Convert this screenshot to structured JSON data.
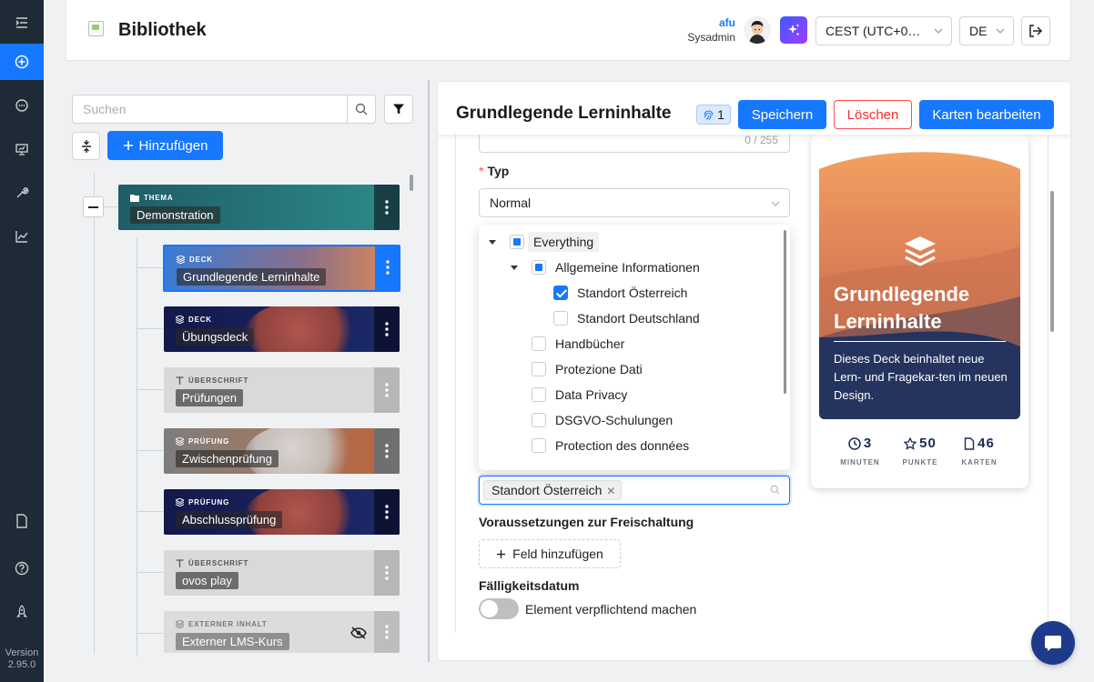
{
  "sidebar": {
    "icons": [
      "menu-icon",
      "add-circle-icon",
      "chat-icon",
      "presentation-icon",
      "tools-icon",
      "chart-icon",
      "document-icon",
      "help-icon",
      "rocket-icon"
    ],
    "version_label": "Version",
    "version_number": "2.95.0"
  },
  "header": {
    "title": "Bibliothek",
    "user_name": "afu",
    "user_role": "Sysadmin",
    "timezone": "CEST (UTC+0…",
    "language": "DE"
  },
  "tree": {
    "search_placeholder": "Suchen",
    "add_label": "Hinzufügen",
    "nodes": [
      {
        "type": "THEMA",
        "label": "Demonstration"
      },
      {
        "type": "DECK",
        "label": "Grundlegende Lerninhalte"
      },
      {
        "type": "DECK",
        "label": "Übungsdeck"
      },
      {
        "type": "ÜBERSCHRIFT",
        "label": "Prüfungen"
      },
      {
        "type": "PRÜFUNG",
        "label": "Zwischenprüfung"
      },
      {
        "type": "PRÜFUNG",
        "label": "Abschlussprüfung"
      },
      {
        "type": "ÜBERSCHRIFT",
        "label": "ovos play"
      },
      {
        "type": "EXTERNER INHALT",
        "label": "Externer LMS-Kurs"
      }
    ]
  },
  "editor": {
    "title": "Grundlegende Lerninhalte",
    "badge_count": "1",
    "save_label": "Speichern",
    "delete_label": "Löschen",
    "edit_cards_label": "Karten bearbeiten",
    "prev_counter": "0 / 255",
    "type_label": "Typ",
    "type_value": "Normal",
    "tree_options": [
      {
        "label": "Everything",
        "state": "partial"
      },
      {
        "label": "Allgemeine Informationen",
        "state": "partial"
      },
      {
        "label": "Standort Österreich",
        "state": "checked"
      },
      {
        "label": "Standort Deutschland",
        "state": "unchecked"
      },
      {
        "label": "Handbücher",
        "state": "unchecked"
      },
      {
        "label": "Protezione Dati",
        "state": "unchecked"
      },
      {
        "label": "Data Privacy",
        "state": "unchecked"
      },
      {
        "label": "DSGVO-Schulungen",
        "state": "unchecked"
      },
      {
        "label": "Protection des données",
        "state": "unchecked"
      }
    ],
    "selected_tag": "Standort Österreich",
    "prereq_label": "Voraussetzungen zur Freischaltung",
    "add_field_label": "Feld hinzufügen",
    "due_label": "Fälligkeitsdatum",
    "mandatory_label": "Element verpflichtend machen",
    "mandatory_on": false
  },
  "card": {
    "title": "Grundlegende Lerninhalte",
    "description": "Dieses Deck beinhaltet neue Lern- und Fragekar-ten im neuen Design.",
    "stats": [
      {
        "value": "3",
        "label": "MINUTEN",
        "icon": "clock-icon"
      },
      {
        "value": "50",
        "label": "PUNKTE",
        "icon": "star-icon"
      },
      {
        "value": "46",
        "label": "KARTEN",
        "icon": "file-icon"
      }
    ]
  },
  "colors": {
    "accent": "#1677ff",
    "danger": "#ff4d4f",
    "rail": "#1e2a36",
    "card_navy": "#24345e",
    "card_orange": "#f4a461"
  }
}
